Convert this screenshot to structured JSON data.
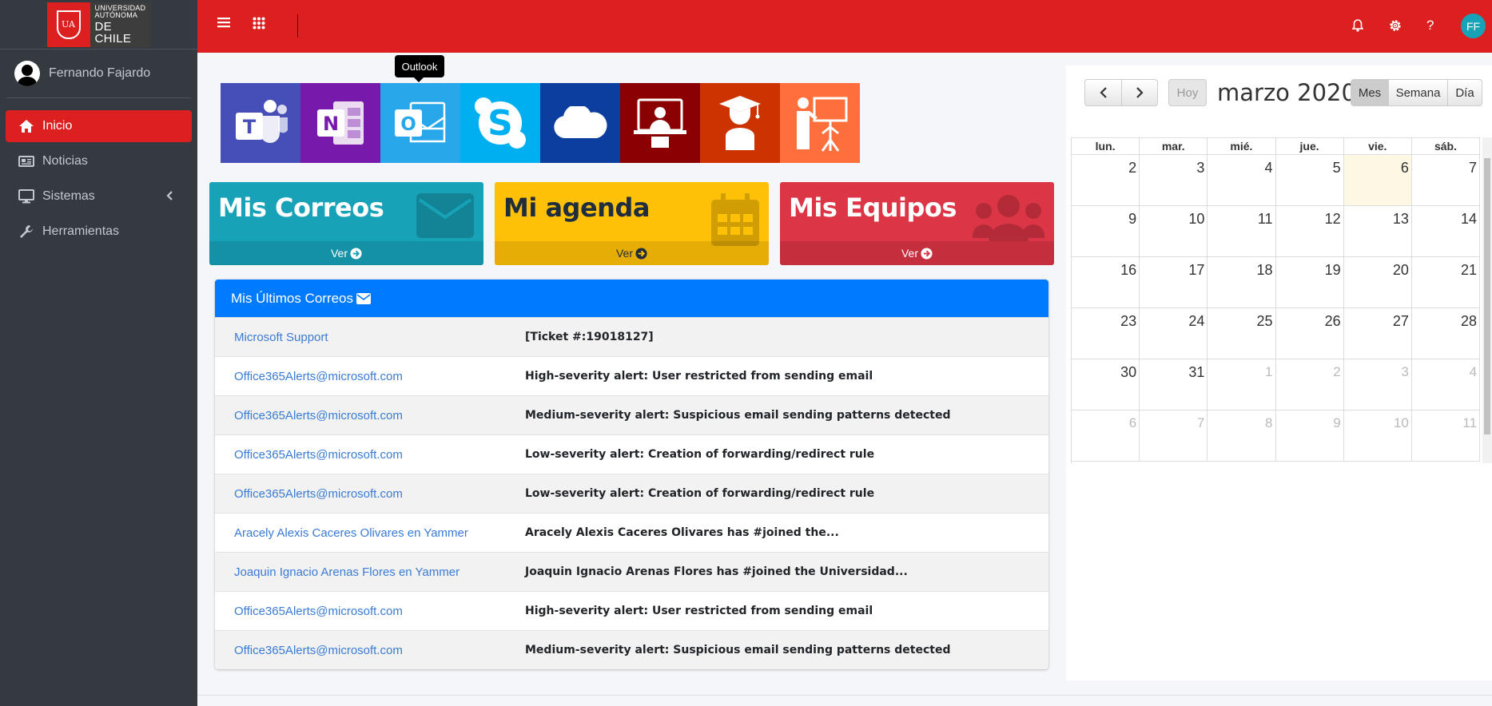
{
  "brand": {
    "line1": "UNIVERSIDAD",
    "line2": "AUTÓNOMA",
    "line3": "DE CHILE",
    "seal": "UA"
  },
  "user": {
    "name": "Fernando Fajardo",
    "initials": "FF"
  },
  "sidebar": {
    "items": [
      {
        "label": "Inicio",
        "icon": "home-icon",
        "active": true
      },
      {
        "label": "Noticias",
        "icon": "newspaper-icon"
      },
      {
        "label": "Sistemas",
        "icon": "desktop-icon",
        "has_submenu": true
      },
      {
        "label": "Herramientas",
        "icon": "wrench-icon"
      }
    ]
  },
  "topbar": {
    "icons": [
      "menu-icon",
      "apps-grid-icon",
      "bell-icon",
      "gear-icon",
      "help-icon"
    ],
    "accent": "#dc2020"
  },
  "tooltip": {
    "text": "Outlook"
  },
  "apps": [
    {
      "name": "Teams",
      "color": "#464eb8"
    },
    {
      "name": "OneNote",
      "color": "#7719aa"
    },
    {
      "name": "Outlook",
      "color": "#28a8ea"
    },
    {
      "name": "Skype",
      "color": "#00aff0"
    },
    {
      "name": "OneDrive",
      "color": "#0b3e9e"
    },
    {
      "name": "Aula virtual",
      "color": "#8b0000"
    },
    {
      "name": "Alumno",
      "color": "#cc3300"
    },
    {
      "name": "Docente",
      "color": "#ff6f3c"
    }
  ],
  "boxes": [
    {
      "title": "Mis Correos",
      "footer": "Ver",
      "color": "#17a2b8"
    },
    {
      "title": "Mi agenda",
      "footer": "Ver",
      "color": "#ffc107"
    },
    {
      "title": "Mis Equipos",
      "footer": "Ver",
      "color": "#dc3545"
    }
  ],
  "mail": {
    "header": "Mis Últimos Correos",
    "rows": [
      {
        "from": "Microsoft Support",
        "subject": "[Ticket #:19018127]"
      },
      {
        "from": "Office365Alerts@microsoft.com",
        "subject": "High-severity alert: User restricted from sending email"
      },
      {
        "from": "Office365Alerts@microsoft.com",
        "subject": "Medium-severity alert: Suspicious email sending patterns detected"
      },
      {
        "from": "Office365Alerts@microsoft.com",
        "subject": "Low-severity alert: Creation of forwarding/redirect rule"
      },
      {
        "from": "Office365Alerts@microsoft.com",
        "subject": "Low-severity alert: Creation of forwarding/redirect rule"
      },
      {
        "from": "Aracely Alexis Caceres Olivares en Yammer",
        "subject": "Aracely Alexis Caceres Olivares has #joined the..."
      },
      {
        "from": "Joaquin Ignacio Arenas Flores en Yammer",
        "subject": "Joaquin Ignacio Arenas Flores has #joined the Universidad..."
      },
      {
        "from": "Office365Alerts@microsoft.com",
        "subject": "High-severity alert: User restricted from sending email"
      },
      {
        "from": "Office365Alerts@microsoft.com",
        "subject": "Medium-severity alert: Suspicious email sending patterns detected"
      }
    ]
  },
  "calendar": {
    "title": "marzo 2020",
    "today_label": "Hoy",
    "views": [
      "Mes",
      "Semana",
      "Día"
    ],
    "active_view": "Mes",
    "weekdays": [
      "lun.",
      "mar.",
      "mié.",
      "jue.",
      "vie.",
      "sáb."
    ],
    "weeks": [
      [
        "2",
        "3",
        "4",
        "5",
        "6",
        "7"
      ],
      [
        "9",
        "10",
        "11",
        "12",
        "13",
        "14"
      ],
      [
        "16",
        "17",
        "18",
        "19",
        "20",
        "21"
      ],
      [
        "23",
        "24",
        "25",
        "26",
        "27",
        "28"
      ],
      [
        "30",
        "31",
        "1",
        "2",
        "3",
        "4"
      ],
      [
        "6",
        "7",
        "8",
        "9",
        "10",
        "11"
      ]
    ],
    "today": "6"
  }
}
